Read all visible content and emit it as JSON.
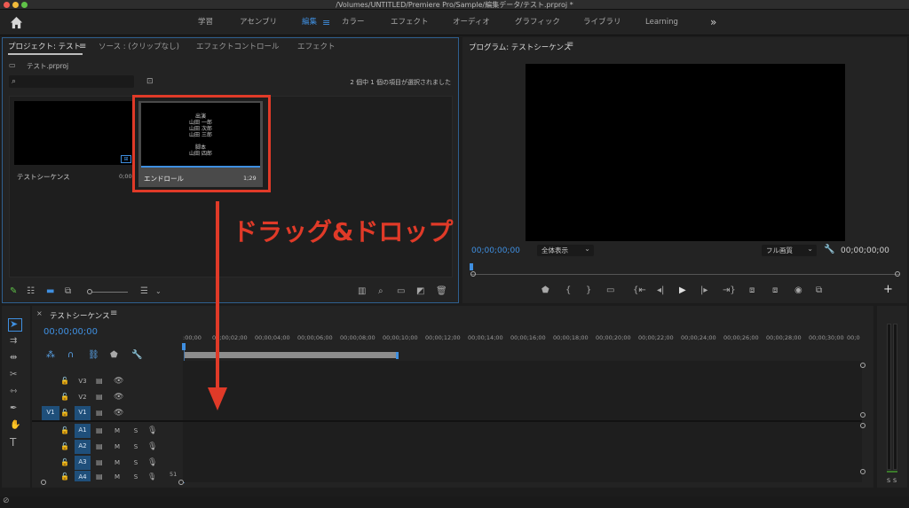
{
  "window": {
    "title": "/Volumes/UNTITLED/Premiere Pro/Sample/編集データ/テスト.prproj *"
  },
  "workspaces": {
    "items": [
      "学習",
      "アセンブリ",
      "編集",
      "カラー",
      "エフェクト",
      "オーディオ",
      "グラフィック",
      "ライブラリ",
      "Learning"
    ],
    "active": "編集",
    "more": "»"
  },
  "project_panel": {
    "tabs": [
      "プロジェクト: テスト",
      "ソース : (クリップなし)",
      "エフェクトコントロール",
      "エフェクト"
    ],
    "file_name": "テスト.prproj",
    "search_placeholder": "",
    "selection_status": "2 個中 1 個の項目が選択されました",
    "items": [
      {
        "name": "テストシーケンス",
        "duration": "0;00"
      },
      {
        "name": "エンドロール",
        "duration": "1;29",
        "credits": [
          "出演",
          "山田 一郎",
          "山田 次郎",
          "山田 三郎",
          "",
          "脚本",
          "山田 四郎"
        ]
      }
    ]
  },
  "program_monitor": {
    "title": "プログラム: テストシーケンス",
    "timecode_left": "00;00;00;00",
    "zoom": "全体表示",
    "quality": "フル画質",
    "timecode_right": "00;00;00;00",
    "add": "+"
  },
  "annotation": {
    "text": "ドラッグ&ドロップ",
    "color": "#e03a28"
  },
  "timeline": {
    "title": "テストシーケンス",
    "timecode": "00;00;00;00",
    "ruler": [
      ":00;00",
      "00;00;02;00",
      "00;00;04;00",
      "00;00;06;00",
      "00;00;08;00",
      "00;00;10;00",
      "00;00;12;00",
      "00;00;14;00",
      "00;00;16;00",
      "00;00;18;00",
      "00;00;20;00",
      "00;00;22;00",
      "00;00;24;00",
      "00;00;26;00",
      "00;00;28;00",
      "00;00;30;00",
      "00;0"
    ],
    "video_tracks": [
      {
        "source": "",
        "name": "V3"
      },
      {
        "source": "",
        "name": "V2"
      },
      {
        "source": "V1",
        "name": "V1"
      }
    ],
    "audio_tracks": [
      {
        "name": "A1",
        "m": "M",
        "s": "S"
      },
      {
        "name": "A2",
        "m": "M",
        "s": "S"
      },
      {
        "name": "A3",
        "m": "M",
        "s": "S"
      },
      {
        "name": "A4",
        "m": "M",
        "s": "S",
        "level": "51"
      }
    ],
    "meter_labels": [
      "S",
      "S"
    ]
  },
  "colors": {
    "accent": "#3f8fe0",
    "highlight": "#e03a28"
  }
}
